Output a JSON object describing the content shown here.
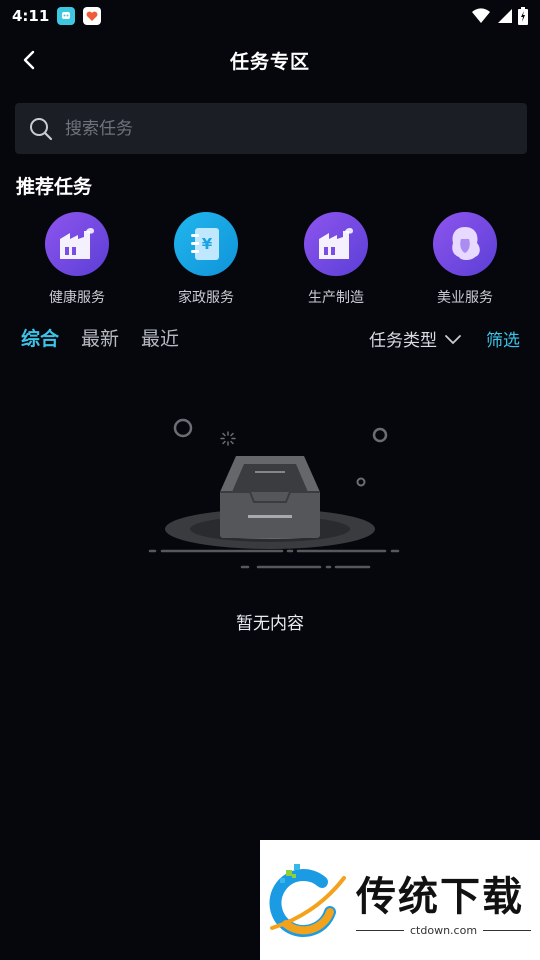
{
  "status": {
    "time": "4:11"
  },
  "header": {
    "title": "任务专区"
  },
  "search": {
    "placeholder": "搜索任务"
  },
  "recommend": {
    "title": "推荐任务",
    "items": [
      {
        "label": "健康服务",
        "icon": "factory-icon",
        "color": "#7a4ee6"
      },
      {
        "label": "家政服务",
        "icon": "notebook-yen-icon",
        "color": "#1ea9e6"
      },
      {
        "label": "生产制造",
        "icon": "factory-icon",
        "color": "#7a4ee6"
      },
      {
        "label": "美业服务",
        "icon": "woman-hair-icon",
        "color": "#7a4ee6"
      }
    ]
  },
  "tabs": [
    {
      "label": "综合",
      "active": true
    },
    {
      "label": "最新",
      "active": false
    },
    {
      "label": "最近",
      "active": false
    }
  ],
  "filters": {
    "type_label": "任务类型",
    "filter_label": "筛选"
  },
  "empty": {
    "text": "暂无内容"
  },
  "watermark": {
    "title": "传统下载",
    "site": "ctdown.com"
  },
  "colors": {
    "accent": "#3cc3e6",
    "background": "#05070d",
    "search_bg": "#1b1e25"
  }
}
